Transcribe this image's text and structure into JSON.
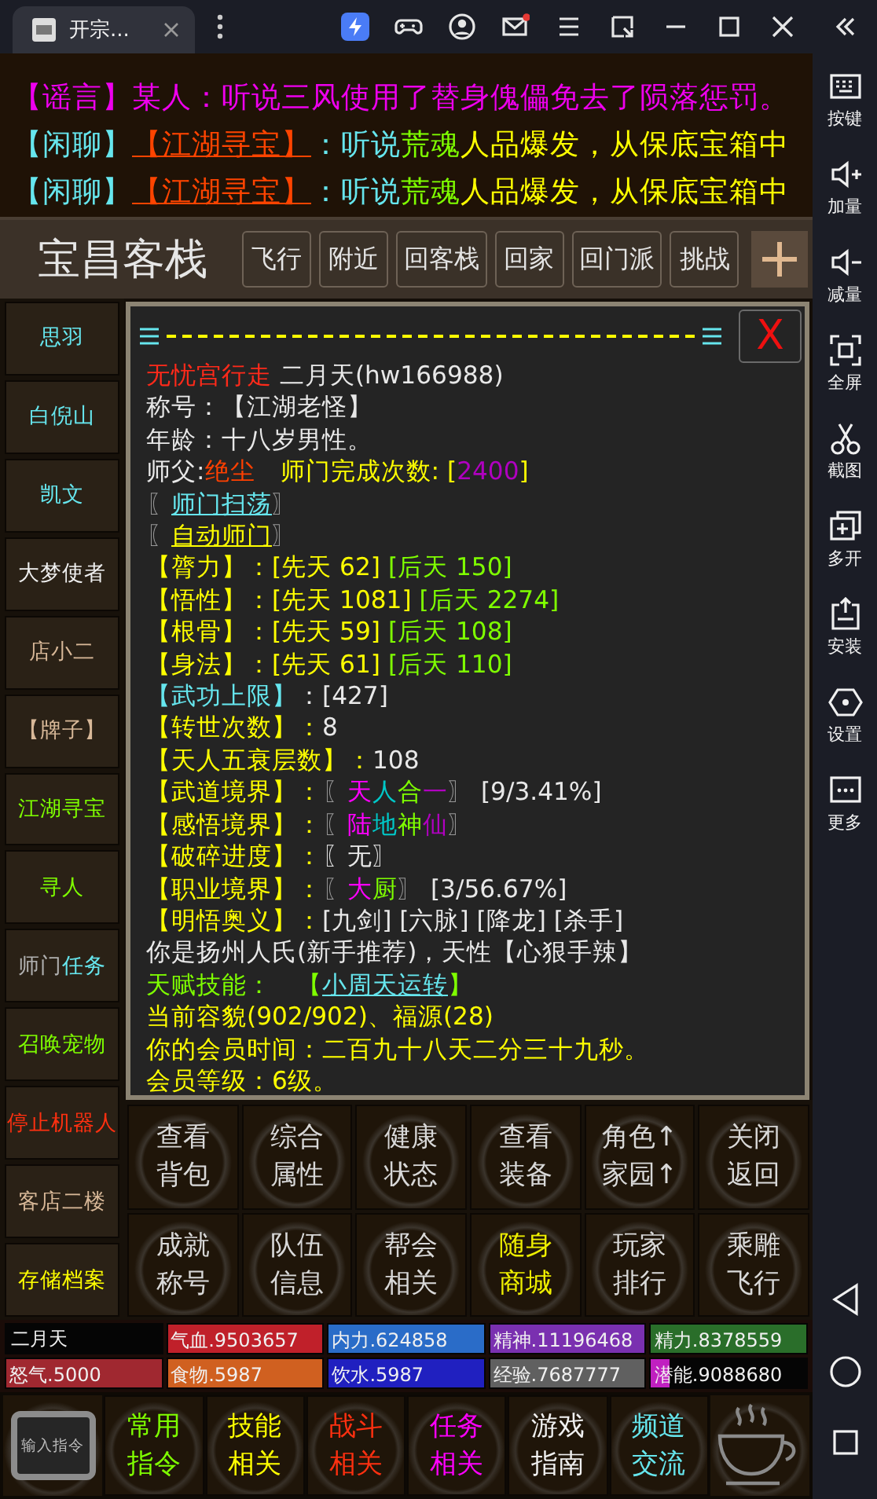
{
  "tab": {
    "title": "开宗..."
  },
  "chat": [
    [
      {
        "text": "【谣言】某人：听说三风使用了替身傀儡免去了陨落惩罚。",
        "color": "#ee00ee"
      }
    ],
    [
      {
        "text": "【闲聊】",
        "color": "#66e6ee"
      },
      {
        "link": "【江湖寻宝】",
        "color": "#ff4400"
      },
      {
        "text": "：听说",
        "color": "#66e6ee"
      },
      {
        "text": "荒魂",
        "color": "#7fff00"
      },
      {
        "text": "人品爆发，从保底宝箱中",
        "color": "#ffff00"
      }
    ],
    [
      {
        "text": "【闲聊】",
        "color": "#66e6ee"
      },
      {
        "link": "【江湖寻宝】",
        "color": "#ff4400"
      },
      {
        "text": "：听说",
        "color": "#66e6ee"
      },
      {
        "text": "荒魂",
        "color": "#7fff00"
      },
      {
        "text": "人品爆发，从保底宝箱中",
        "color": "#ffff00"
      }
    ]
  ],
  "location": {
    "title": "宝昌客栈",
    "buttons": [
      "飞行",
      "附近",
      "回客栈",
      "回家",
      "回门派",
      "挑战"
    ]
  },
  "npcs": [
    [
      {
        "text": "思羽",
        "color": "#66e6ee"
      }
    ],
    [
      {
        "text": "白倪山",
        "color": "#66e6ee"
      }
    ],
    [
      {
        "text": "凯文",
        "color": "#66e6ee"
      }
    ],
    [
      {
        "text": "大梦使者",
        "color": "#f0f0f0"
      }
    ],
    [
      {
        "text": "店小二",
        "color": "#d8b898"
      }
    ],
    [
      {
        "text": "【牌子】",
        "color": "#d8b898"
      }
    ],
    [
      {
        "text": "江湖寻宝",
        "color": "#7fff00"
      }
    ],
    [
      {
        "text": "寻人",
        "color": "#7fff00"
      }
    ],
    [
      {
        "text": "师门",
        "color": "#b0b0b0"
      },
      {
        "text": "任务",
        "color": "#66e6ee"
      }
    ],
    [
      {
        "text": "召唤宠物",
        "color": "#7fff00"
      }
    ],
    [
      {
        "text": "停止机器人",
        "color": "#ff3010"
      }
    ],
    [
      {
        "text": "客店二楼",
        "color": "#d8b898"
      }
    ],
    [
      {
        "text": "存储档案",
        "color": "#ffff00"
      }
    ]
  ],
  "panel": {
    "close": "X",
    "lines": [
      [
        {
          "text": "无忧宫行走",
          "color": "#ff2a1a"
        },
        {
          "text": " 二月天(hw166988)",
          "color": "#e8e8e8"
        }
      ],
      [
        {
          "text": "称号：【江湖老怪】",
          "color": "#e8e8e8"
        }
      ],
      [
        {
          "text": "年龄：十八岁男性。",
          "color": "#e8e8e8"
        }
      ],
      [
        {
          "text": "师父:",
          "color": "#e8e8e8"
        },
        {
          "text": "绝尘",
          "color": "#ff4000"
        },
        {
          "text": "　师门完成次数: [",
          "color": "#ffff00"
        },
        {
          "text": "2400",
          "color": "#b000c0"
        },
        {
          "text": "]",
          "color": "#ffff00"
        }
      ],
      [
        {
          "text": "〖",
          "color": "#999999"
        },
        {
          "link": "师门扫荡",
          "color": "#66e6ee"
        },
        {
          "text": "〗",
          "color": "#999999"
        }
      ],
      [
        {
          "text": "〖",
          "color": "#999999"
        },
        {
          "link": "自动师门",
          "color": "#ffff00"
        },
        {
          "text": "〗",
          "color": "#999999"
        }
      ],
      [
        {
          "text": "【膂力】：[先天 62] ",
          "color": "#ffff00"
        },
        {
          "text": "[后天 150]",
          "color": "#7fff00"
        }
      ],
      [
        {
          "text": "【悟性】：[先天 1081] ",
          "color": "#ffff00"
        },
        {
          "text": "[后天 2274]",
          "color": "#7fff00"
        }
      ],
      [
        {
          "text": "【根骨】：[先天 59] ",
          "color": "#ffff00"
        },
        {
          "text": "[后天 108]",
          "color": "#7fff00"
        }
      ],
      [
        {
          "text": "【身法】：[先天 61] ",
          "color": "#ffff00"
        },
        {
          "text": "[后天 110]",
          "color": "#7fff00"
        }
      ],
      [
        {
          "text": "【武功上限】",
          "color": "#66e6ee"
        },
        {
          "text": "：[427]",
          "color": "#e8e8e8"
        }
      ],
      [
        {
          "text": "【转世次数】：",
          "color": "#ffff00"
        },
        {
          "text": "8",
          "color": "#e8e8e8"
        }
      ],
      [
        {
          "text": "【天人五衰层数】：",
          "color": "#ffff00"
        },
        {
          "text": "108",
          "color": "#e8e8e8"
        }
      ],
      [
        {
          "text": "【武道境界】：",
          "color": "#ffff00"
        },
        {
          "text": "〖",
          "color": "#999999"
        },
        {
          "text": "天",
          "color": "#ff00ff"
        },
        {
          "text": "人",
          "color": "#00c8c8"
        },
        {
          "text": "合",
          "color": "#7fff00"
        },
        {
          "text": "一",
          "color": "#b000c0"
        },
        {
          "text": "〗",
          "color": "#999999"
        },
        {
          "text": " [9/3.41%]",
          "color": "#e8e8e8"
        }
      ],
      [
        {
          "text": "【感悟境界】：",
          "color": "#ffff00"
        },
        {
          "text": "〖",
          "color": "#999999"
        },
        {
          "text": "陆",
          "color": "#ff00ff"
        },
        {
          "text": "地",
          "color": "#00c8c8"
        },
        {
          "text": "神",
          "color": "#7fff00"
        },
        {
          "text": "仙",
          "color": "#b000c0"
        },
        {
          "text": "〗",
          "color": "#999999"
        }
      ],
      [
        {
          "text": "【破碎进度】：",
          "color": "#ffff00"
        },
        {
          "text": "〖无〗",
          "color": "#e8e8e8"
        }
      ],
      [
        {
          "text": "【职业境界】：",
          "color": "#ffff00"
        },
        {
          "text": "〖",
          "color": "#999999"
        },
        {
          "text": "大",
          "color": "#ff00ff"
        },
        {
          "text": "厨",
          "color": "#7fff00"
        },
        {
          "text": "〗",
          "color": "#999999"
        },
        {
          "text": " [3/56.67%]",
          "color": "#e8e8e8"
        }
      ],
      [
        {
          "text": "【明悟奥义】：",
          "color": "#ffff00"
        },
        {
          "text": "[九剑] [六脉] [降龙] [杀手]",
          "color": "#e8e8e8"
        }
      ],
      [
        {
          "text": "你是扬州人氏(新手推荐)，天性【心狠手辣】",
          "color": "#e8e8e8"
        }
      ],
      [
        {
          "text": "天赋技能：　【",
          "color": "#7fff00"
        },
        {
          "link": "小周天运转",
          "color": "#66e6ee"
        },
        {
          "text": "】",
          "color": "#7fff00"
        }
      ],
      [
        {
          "text": "当前容貌(902/902)、福源(28)",
          "color": "#ffff00"
        }
      ],
      [
        {
          "text": "你的会员时间：二百九十八天二分三十九秒。",
          "color": "#ffff00"
        }
      ],
      [
        {
          "text": "会员等级：6级。",
          "color": "#ffff00"
        }
      ]
    ]
  },
  "actions": [
    {
      "lines": [
        "查看",
        "背包"
      ],
      "color": "#d8d8d8"
    },
    {
      "lines": [
        "综合",
        "属性"
      ],
      "color": "#d8d8d8"
    },
    {
      "lines": [
        "健康",
        "状态"
      ],
      "color": "#d8d8d8"
    },
    {
      "lines": [
        "查看",
        "装备"
      ],
      "color": "#d8d8d8"
    },
    {
      "lines": [
        "角色↑",
        "家园↑"
      ],
      "color": "#d8d8d8"
    },
    {
      "lines": [
        "关闭",
        "返回"
      ],
      "color": "#d8d8d8"
    },
    {
      "lines": [
        "成就",
        "称号"
      ],
      "color": "#d8d8d8"
    },
    {
      "lines": [
        "队伍",
        "信息"
      ],
      "color": "#d8d8d8"
    },
    {
      "lines": [
        "帮会",
        "相关"
      ],
      "color": "#d8d8d8"
    },
    {
      "lines": [
        "随身",
        "商城"
      ],
      "color": "#eeee00"
    },
    {
      "lines": [
        "玩家",
        "排行"
      ],
      "color": "#d8d8d8"
    },
    {
      "lines": [
        "乘雕",
        "飞行"
      ],
      "color": "#d8d8d8"
    }
  ],
  "stats": [
    {
      "kind": "name",
      "label": "二月天"
    },
    {
      "kind": "bar",
      "label": "气血.9503657",
      "color": "#c0202a",
      "level": 1
    },
    {
      "kind": "bar",
      "label": "内力.624858",
      "color": "#2a6cc8",
      "level": 1
    },
    {
      "kind": "bar",
      "label": "精神.11196468",
      "color": "#7a30b0",
      "level": 1
    },
    {
      "kind": "bar",
      "label": "精力.8378559",
      "color": "#2a6e2a",
      "level": 1
    },
    {
      "kind": "bar",
      "label": "怒气.5000",
      "color": "#a02830",
      "level": 1
    },
    {
      "kind": "bar",
      "label": "食物.5987",
      "color": "#d06020",
      "level": 1
    },
    {
      "kind": "bar",
      "label": "饮水.5987",
      "color": "#2020c0",
      "level": 1
    },
    {
      "kind": "bar",
      "label": "经验.7687777",
      "color": "#606060",
      "level": 1
    },
    {
      "kind": "bar",
      "label": "潜能.9088680",
      "color": "#c020c0",
      "level": 0.12
    }
  ],
  "command_button": {
    "label": "输入指令"
  },
  "menu": [
    {
      "lines": [
        "常用",
        "指令"
      ],
      "color": "#7fff00"
    },
    {
      "lines": [
        "技能",
        "相关"
      ],
      "color": "#ffff00"
    },
    {
      "lines": [
        "战斗",
        "相关"
      ],
      "color": "#ff3010"
    },
    {
      "lines": [
        "任务",
        "相关"
      ],
      "color": "#ff00ff"
    },
    {
      "lines": [
        "游戏",
        "指南"
      ],
      "color": "#f0f0f0"
    },
    {
      "lines": [
        "频道",
        "交流"
      ],
      "color": "#66e6ee"
    }
  ],
  "toolbar": [
    "按键",
    "加量",
    "减量",
    "全屏",
    "截图",
    "多开",
    "安装",
    "设置",
    "更多"
  ]
}
